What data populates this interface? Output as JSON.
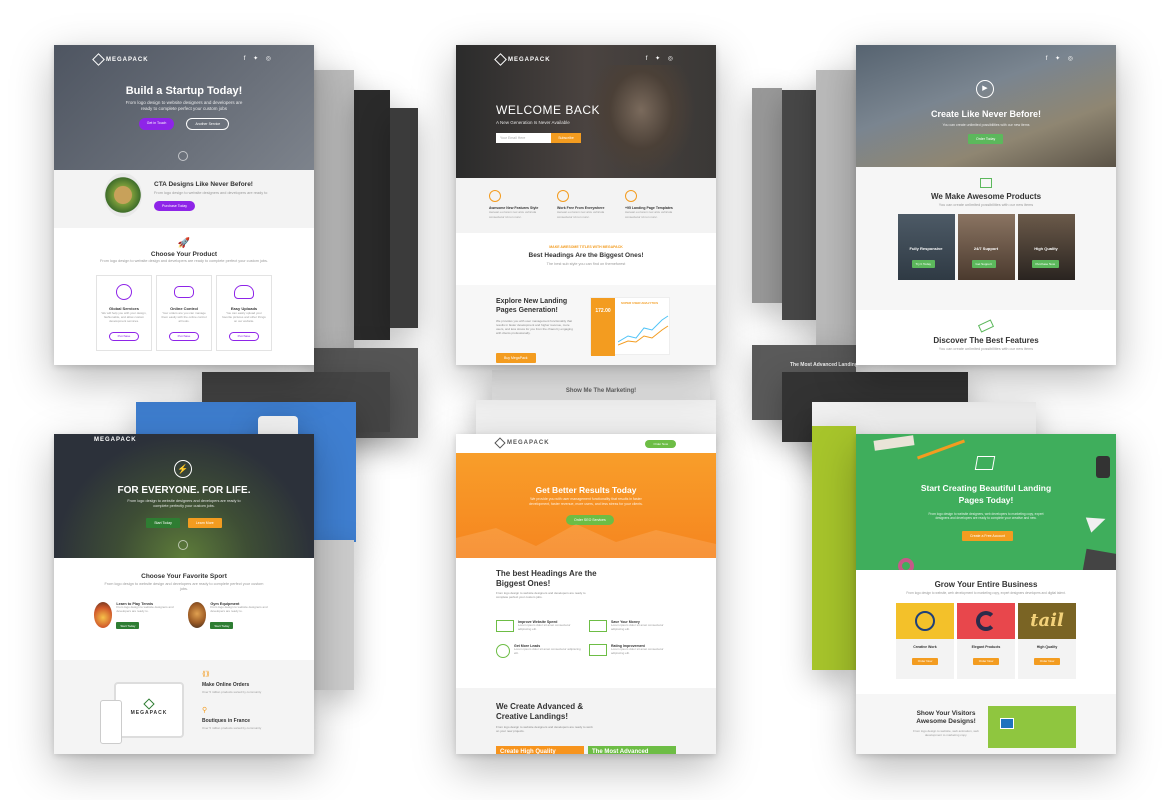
{
  "cards": {
    "c1": {
      "logo": "MEGAPACK",
      "social": "f ✦ ◎",
      "hero_title": "Build a Startup Today!",
      "hero_sub": "From logo design to website designers and developers are ready to complete perfect your custom jobs",
      "btn1": "Get in Touch",
      "btn2": "Another Service",
      "cta_title": "CTA Designs Like Never Before!",
      "cta_sub": "From logo design to website designers and developers are ready to",
      "cta_btn": "Purchase Today",
      "section_title": "Choose Your Product",
      "section_sub": "From logo design to website design and developers are ready to complete perfect your custom jobs.",
      "features": [
        {
          "title": "Global Services",
          "text": "We will help you with your design, fashionable, and allow custom development services.",
          "btn": "Purchase"
        },
        {
          "title": "Online Control",
          "text": "Your orders are you can manage them easily with the online control all tools.",
          "btn": "Purchase"
        },
        {
          "title": "Easy Uploads",
          "text": "You can easily upload your favorite pictures and other things on our website.",
          "btn": "Purchase"
        }
      ],
      "accent": "#8e24e8"
    },
    "c2": {
      "logo": "MEGAPACK",
      "social": "f ✦ ◎",
      "hero_title": "WELCOME BACK",
      "hero_sub": "A New Generation Is Never Available",
      "input_placeholder": "Your Email Here",
      "hero_btn": "Subscribe",
      "features": [
        {
          "title": "Awesome New Features Style",
          "text": "Aenean eu lorem nec arcu vehicula consectetur id non nunc."
        },
        {
          "title": "Work Free From Everywhere",
          "text": "Aenean eu lorem nec arcu vehicula consectetur id non nunc."
        },
        {
          "title": "+95 Landing Page Templates",
          "text": "Aenean eu lorem nec arcu vehicula consectetur id non nunc."
        }
      ],
      "tagline": "MAKE AWESOME TITLES WITH MEGAPACK",
      "section_title": "Best Headings Are the Biggest Ones!",
      "section_sub": "The best sub style you can find on themeforest",
      "explore_title": "Explore New Landing Pages Generation!",
      "explore_text": "We provides you with user management functionality that results in faster development and higher revenue, more users, and less stress for you from the chaos by engaging with clients professionally.",
      "explore_btn": "Buy MegaPack",
      "stat_value": "172.00",
      "stat_header": "SUPER USER ANALYTICS",
      "accent": "#f39c20"
    },
    "c3": {
      "social": "f ✦ ◎",
      "hero_title": "Create Like Never Before!",
      "hero_sub": "You can create unlimited possibilities with our new items",
      "hero_btn": "Order Today",
      "section_title": "We Make Awesome Products",
      "section_sub": "You can create unlimited possibilities with our new items",
      "products": [
        {
          "title": "Fully Responsive",
          "btn": "Try It Today"
        },
        {
          "title": "24/7 Support",
          "btn": "Get Support"
        },
        {
          "title": "High Quality",
          "btn": "Purchase Now"
        }
      ],
      "features_title": "Discover The Best Features",
      "features_sub": "You can create unlimited possibilities with our new items",
      "accent": "#5cb85c"
    },
    "c4": {
      "logo": "MEGAPACK",
      "hero_title": "FOR EVERYONE. FOR LIFE.",
      "hero_sub": "From logo design to website designers and developers are ready to complete perfectly your custom jobs.",
      "btn1": "Start Today",
      "btn2": "Learn More",
      "section_title": "Choose Your Favorite Sport",
      "section_sub": "From logo design to website design and developers are ready to complete perfect your custom jobs.",
      "sports": [
        {
          "title": "Learn to Play Tennis",
          "text": "From logo design to website designers and developers are ready to.",
          "btn": "Start Today"
        },
        {
          "title": "Gym Equipment",
          "text": "From logo design to website designers and developers are ready to.",
          "btn": "Start Today"
        }
      ],
      "promo_logo": "MEGAPACK",
      "promo1_title": "Make Online Orders",
      "promo1_text": "Over 5 million products sorted by community",
      "promo2_title": "Boutiques in France",
      "promo2_text": "Over 5 million products sorted by community",
      "accent": "#2e7d32",
      "accent2": "#f39c20"
    },
    "c5": {
      "logo": "MEGAPACK",
      "nav_btn": "Order Now",
      "hero_title": "Get Better Results Today",
      "hero_sub": "We provide you with user management functionality that results in faster development, faster revenue, more users, and less stress for your clients.",
      "hero_btn": "Order SEO Services",
      "section_title": "The best Headings Are the Biggest Ones!",
      "section_sub": "From logo design to website designers and developers are ready to complete perfect your custom jobs.",
      "features": [
        {
          "title": "Improve Website Speed",
          "text": "Lorem ipsum dolor sit amet consectetur adipiscing elit."
        },
        {
          "title": "Save Your Money",
          "text": "Lorem ipsum dolor sit amet consectetur adipiscing elit."
        },
        {
          "title": "Get More Leads",
          "text": "Lorem ipsum dolor sit amet consectetur adipiscing elit."
        },
        {
          "title": "Rating Improvement",
          "text": "Lorem ipsum dolor sit amet consectetur adipiscing elit."
        }
      ],
      "footer_title": "We Create Advanced & Creative Landings!",
      "footer_sub": "From logo design to website designers and developers are ready to work on your new projects.",
      "box1": "Create High Quality",
      "box2": "The Most Advanced",
      "accent": "#f7941d",
      "green": "#6dbd45"
    },
    "c6": {
      "hero_title": "Start Creating Beautiful Landing Pages Today!",
      "hero_sub": "From logo design to website designers, web developers to marketing copy, expert designers and developers are ready to complete your creative and new.",
      "hero_btn": "Create a Free Account",
      "section_title": "Grow Your Entire Business",
      "section_sub": "From logo design to website, web development to marketing copy, expert designers developers and digital talent.",
      "products": [
        {
          "title": "Creative Work",
          "btn": "Order Now"
        },
        {
          "title": "Elegant Products",
          "btn": "Order Now"
        },
        {
          "title": "High Quality",
          "btn": "Order Now"
        }
      ],
      "tail_word": "tail",
      "show_title": "Show Your Visitors Awesome Designs!",
      "show_sub": "From logo design to website, web animation, web development to marketing copy.",
      "accent": "#f39c20",
      "green": "#3fae5c"
    }
  },
  "background_pages": {
    "p1": "The Most Advanced Landing",
    "p2": "Show Me The Marketing!"
  }
}
